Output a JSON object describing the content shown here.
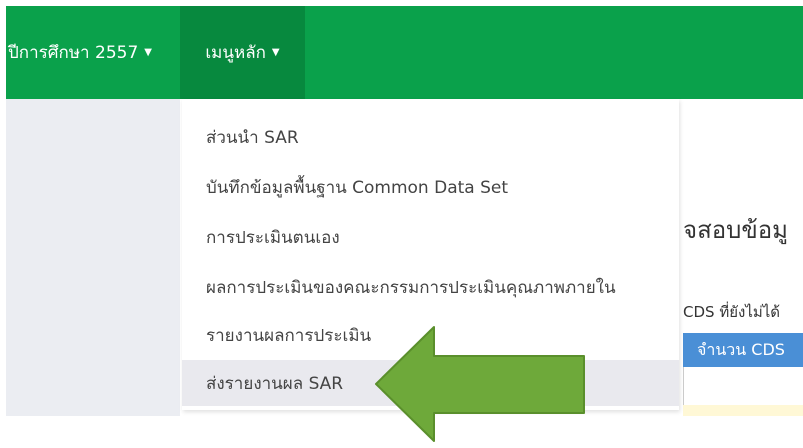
{
  "navbar": {
    "year_label": "ปีการศึกษา 2557",
    "menu_label": "เมนูหลัก"
  },
  "dropdown": {
    "items": [
      {
        "label": "ส่วนนำ SAR"
      },
      {
        "label": "บันทึกข้อมูลพื้นฐาน Common Data Set"
      },
      {
        "label": "การประเมินตนเอง"
      },
      {
        "label": "ผลการประเมินของคณะกรรมการประเมินคุณภาพภายใน"
      },
      {
        "label": "รายงานผลการประเมิน"
      },
      {
        "label": "ส่งรายงานผล SAR"
      }
    ],
    "active_index": 5
  },
  "background": {
    "heading_fragment": "จสอบข้อมู",
    "subtitle_fragment": "CDS ที่ยังไม่ได้",
    "table_header_fragment": "จำนวน CDS"
  },
  "colors": {
    "navbar": "#0aa14b",
    "navbar_active": "#07893e",
    "arrow": "#6ea93a",
    "table_header": "#4a8fd6"
  }
}
